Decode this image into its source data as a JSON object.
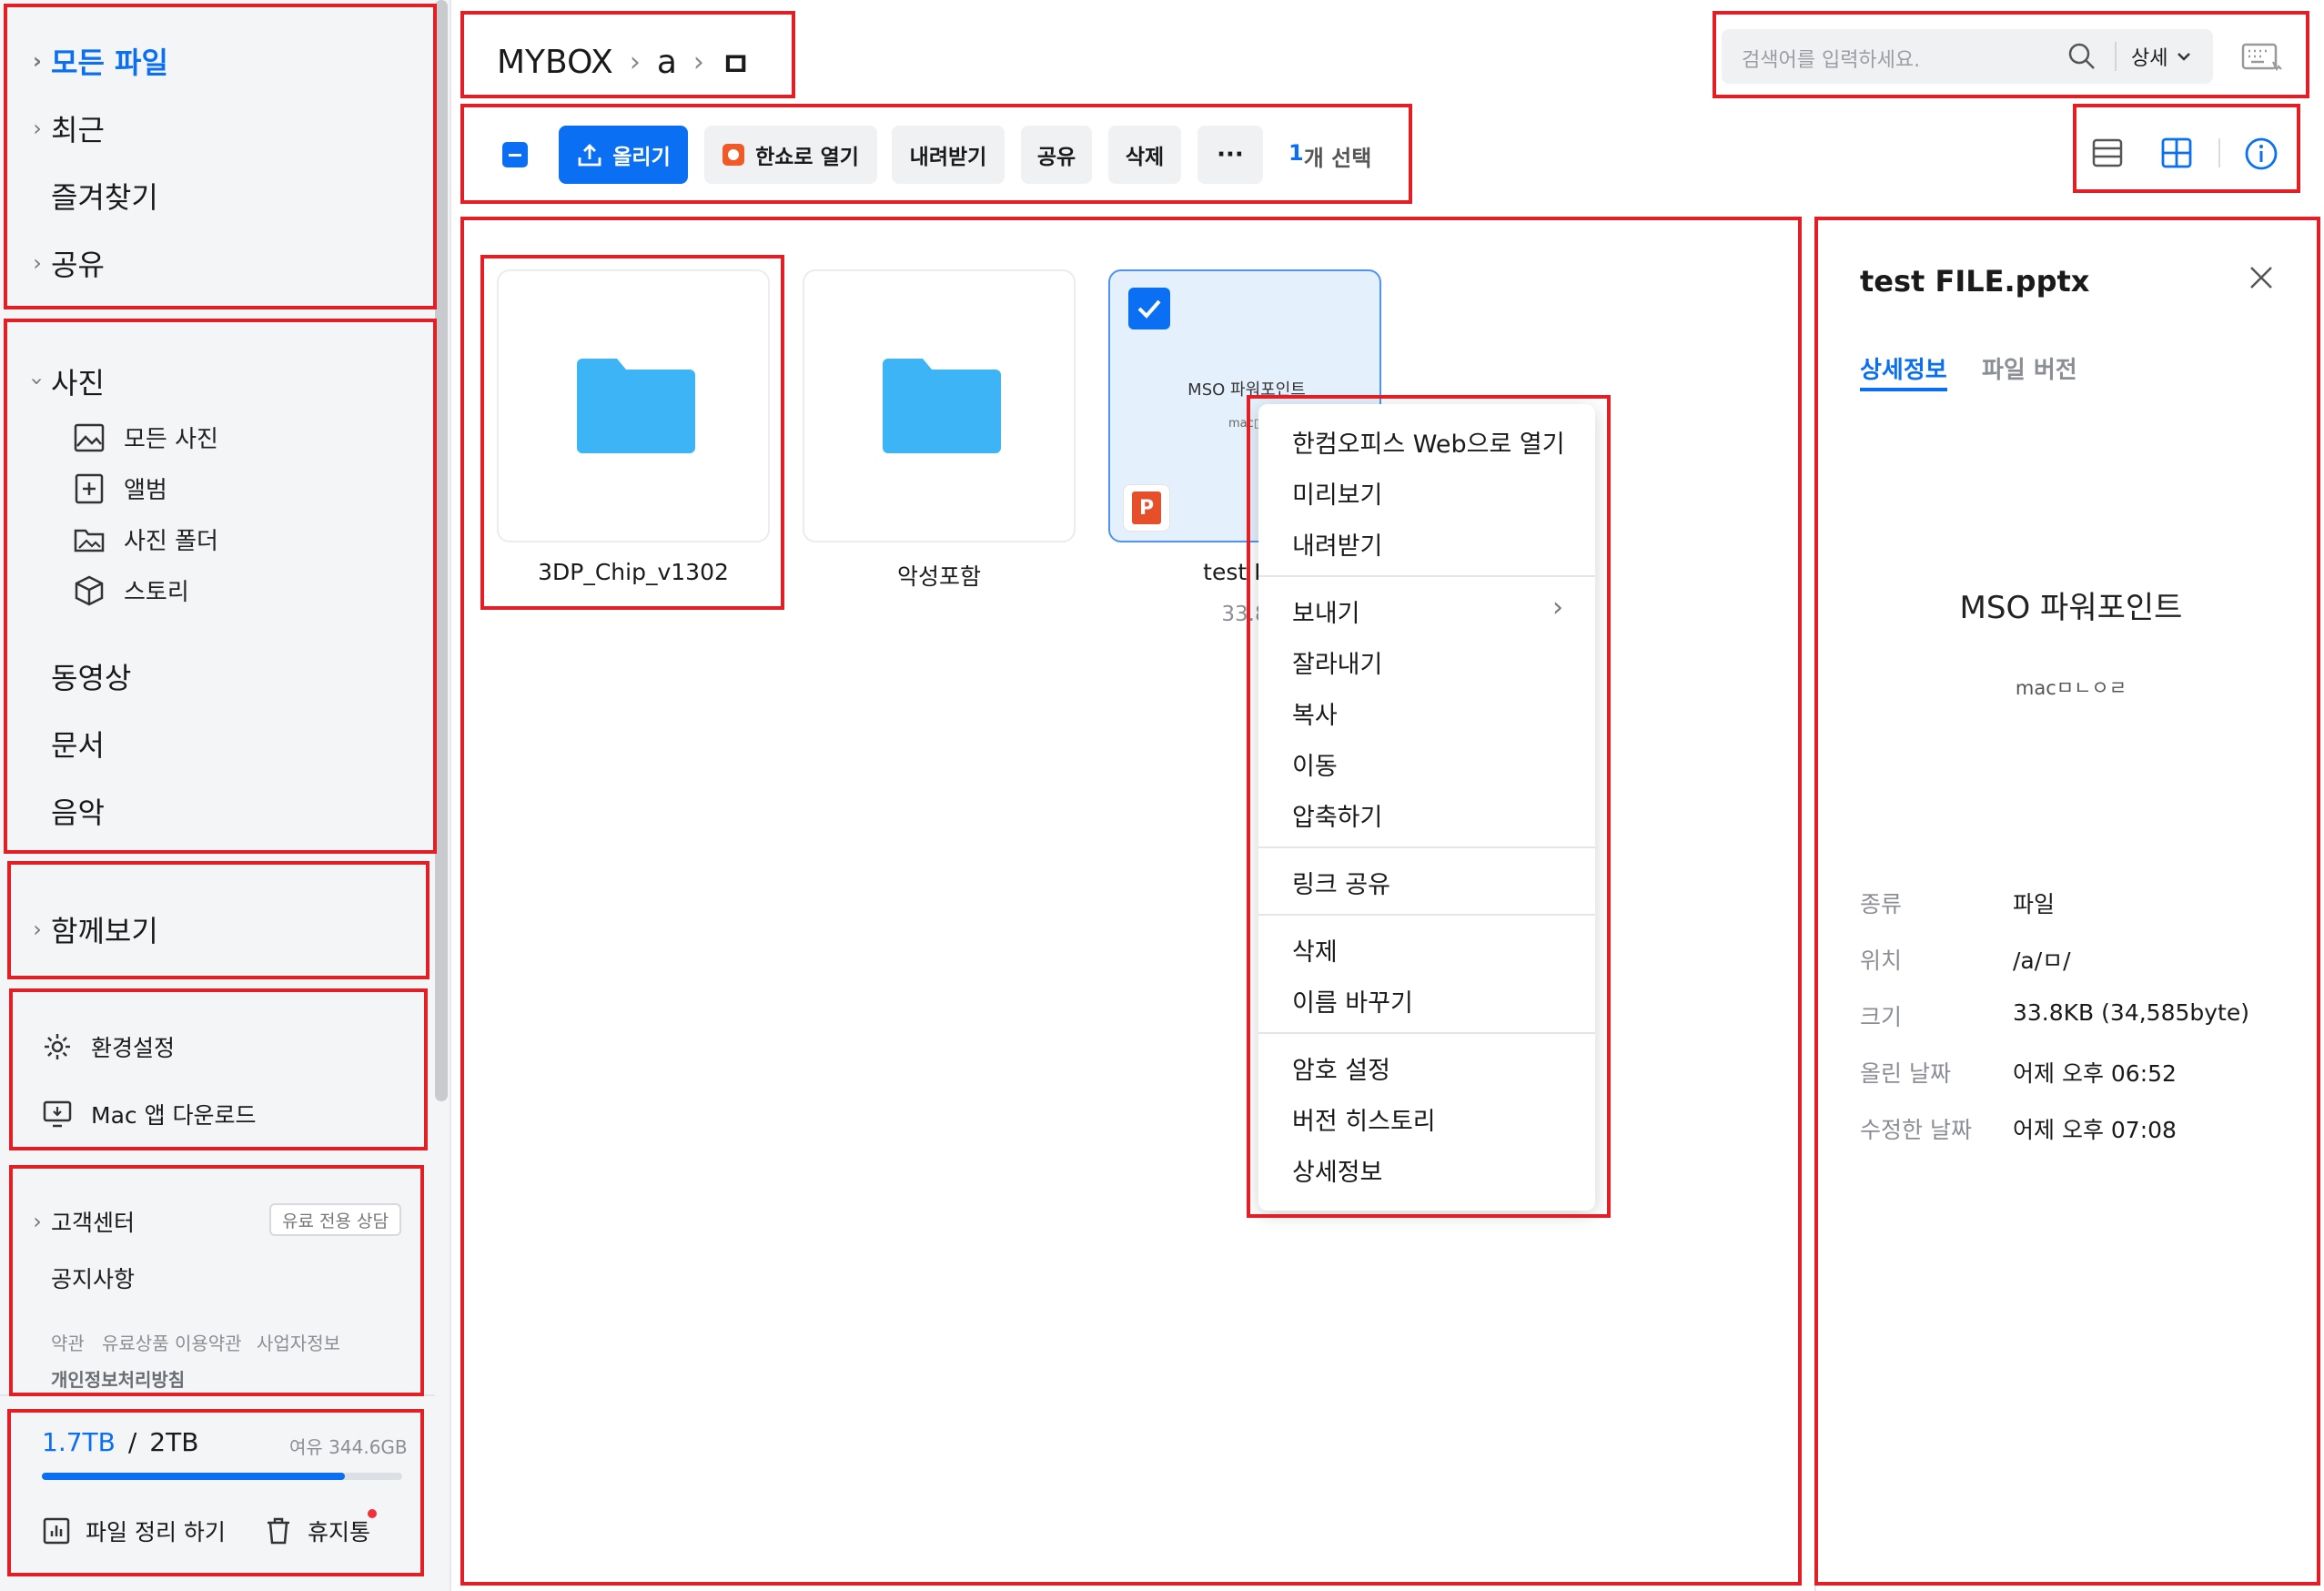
{
  "sidebar": {
    "nav": {
      "all_files": "모든 파일",
      "recent": "최근",
      "favorites": "즐겨찾기",
      "shared": "공유"
    },
    "photos": {
      "title": "사진",
      "items": [
        "모든 사진",
        "앨범",
        "사진 폴더",
        "스토리"
      ]
    },
    "media": {
      "video": "동영상",
      "docs": "문서",
      "music": "음악"
    },
    "together": "함께보기",
    "settings": {
      "prefs": "환경설정",
      "mac_app": "Mac 앱 다운로드"
    },
    "support": {
      "center": "고객센터",
      "badge": "유료 전용 상담",
      "notice": "공지사항",
      "terms": "약관",
      "paid_terms": "유료상품 이용약관",
      "biz_info": "사업자정보",
      "privacy": "개인정보처리방침"
    },
    "storage": {
      "used": "1.7TB",
      "sep": "/",
      "total": "2TB",
      "free": "여유 344.6GB",
      "usage_fraction": 0.84,
      "cleanup": "파일 정리 하기",
      "trash": "휴지통"
    }
  },
  "breadcrumb": {
    "root": "MYBOX",
    "level1": "a",
    "level2": "ㅁ"
  },
  "search": {
    "placeholder": "검색어를 입력하세요.",
    "detail": "상세"
  },
  "toolbar": {
    "upload": "올리기",
    "open_hanshow": "한쇼로 열기",
    "download": "내려받기",
    "share": "공유",
    "delete": "삭제",
    "more": "···",
    "selection_count": "1",
    "selection_text": "개 선택"
  },
  "files": [
    {
      "name": "3DP_Chip_v1302",
      "type": "folder"
    },
    {
      "name": "악성포함",
      "type": "folder"
    },
    {
      "name": "test FIL",
      "type": "pptx",
      "size": "33.8",
      "thumb_title": "MSO 파워포인트",
      "thumb_sub": "mac□"
    }
  ],
  "context_menu": {
    "open_web": "한컴오피스 Web으로 열기",
    "preview": "미리보기",
    "download": "내려받기",
    "send": "보내기",
    "cut": "잘라내기",
    "copy": "복사",
    "move": "이동",
    "compress": "압축하기",
    "link_share": "링크 공유",
    "delete": "삭제",
    "rename": "이름 바꾸기",
    "password": "암호 설정",
    "history": "버전 히스토리",
    "info": "상세정보"
  },
  "details": {
    "filename": "test FILE.pptx",
    "tab_info": "상세정보",
    "tab_versions": "파일 버전",
    "preview_title": "MSO 파워포인트",
    "preview_sub": "macㅁㄴㅇㄹ",
    "rows": [
      {
        "label": "종류",
        "value": "파일"
      },
      {
        "label": "위치",
        "value": "/a/ㅁ/"
      },
      {
        "label": "크기",
        "value": "33.8KB (34,585byte)"
      },
      {
        "label": "올린 날짜",
        "value": "어제 오후 06:52"
      },
      {
        "label": "수정한 날짜",
        "value": "어제 오후 07:08"
      }
    ]
  },
  "colors": {
    "accent": "#0a6ff2",
    "folder": "#3db4f6",
    "annotation": "#e31e24"
  }
}
